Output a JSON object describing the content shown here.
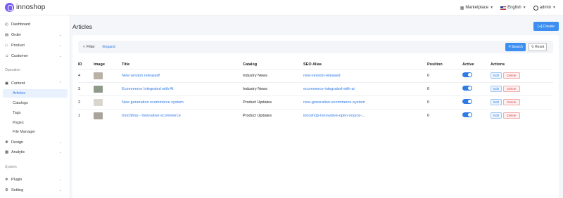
{
  "brand": {
    "name": "innoshop"
  },
  "header": {
    "marketplace": "Marketplace",
    "language": "English",
    "user": "admin"
  },
  "sidebar": {
    "items": [
      {
        "label": "Dashboard",
        "icon": "dashboard-icon"
      },
      {
        "label": "Order",
        "icon": "order-icon"
      },
      {
        "label": "Product",
        "icon": "product-icon"
      },
      {
        "label": "Customer",
        "icon": "customer-icon"
      }
    ],
    "section_operation": "Operation",
    "content": {
      "label": "Content",
      "icon": "content-icon"
    },
    "content_sub": [
      "Articles",
      "Catalogs",
      "Tags",
      "Pages",
      "File Manager"
    ],
    "design": {
      "label": "Design",
      "icon": "design-icon"
    },
    "analytic": {
      "label": "Analytic",
      "icon": "analytic-icon"
    },
    "section_system": "System",
    "plugin": {
      "label": "Plugin",
      "icon": "plugin-icon"
    },
    "setting": {
      "label": "Setting",
      "icon": "setting-icon"
    }
  },
  "page": {
    "title": "Articles",
    "create_label": "Create"
  },
  "filter": {
    "label": "Filter",
    "expand": "Expand",
    "search": "Search",
    "reset": "Reset"
  },
  "table": {
    "headers": [
      "ID",
      "Image",
      "Title",
      "Catalog",
      "SEO Alias",
      "Position",
      "Active",
      "Actions"
    ],
    "edit_label": "Edit",
    "delete_label": "Delete",
    "rows": [
      {
        "id": "4",
        "title": "New version released!",
        "catalog": "Industry News",
        "seo": "new-version-released",
        "position": "0",
        "active": true,
        "thumb_color": "#b9b2a4"
      },
      {
        "id": "3",
        "title": "Ecommerce Integrated with AI",
        "catalog": "Industry News",
        "seo": "ecommerce-integrated-with-ai",
        "position": "0",
        "active": true,
        "thumb_color": "#8f9b88"
      },
      {
        "id": "2",
        "title": "New generation ecommerce system",
        "catalog": "Product Updates",
        "seo": "new-generation-ecommerce-system",
        "position": "0",
        "active": true,
        "thumb_color": "#d9d6cf"
      },
      {
        "id": "1",
        "title": "InnoShop - Innovative ecommerce",
        "catalog": "Product Updates",
        "seo": "innoshop-innovative-open-source-...",
        "position": "0",
        "active": true,
        "thumb_color": "#a9a39a"
      }
    ]
  },
  "colors": {
    "accent": "#3c8ff0",
    "brand": "#7b5cf0",
    "danger": "#e05050"
  }
}
